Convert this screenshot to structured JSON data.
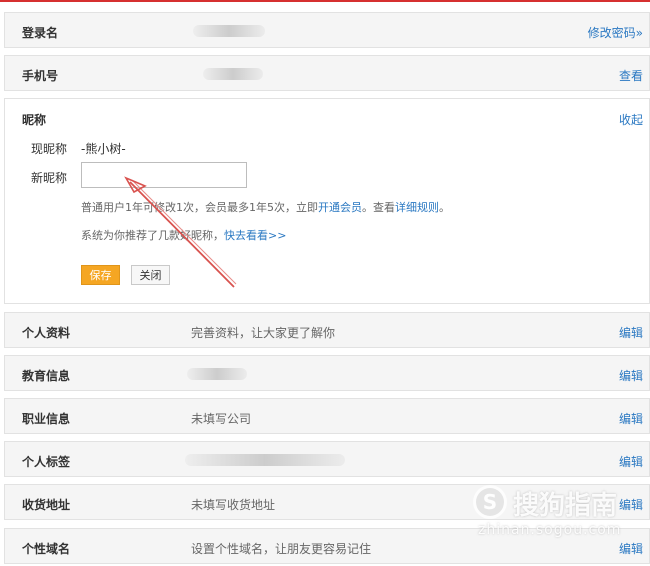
{
  "rows": {
    "login": {
      "label": "登录名",
      "action": "修改密码»"
    },
    "phone": {
      "label": "手机号",
      "action": "查看"
    },
    "profile": {
      "label": "个人资料",
      "value": "完善资料，让大家更了解你",
      "action": "编辑"
    },
    "education": {
      "label": "教育信息",
      "action": "编辑"
    },
    "career": {
      "label": "职业信息",
      "value": "未填写公司",
      "action": "编辑"
    },
    "tags": {
      "label": "个人标签",
      "action": "编辑"
    },
    "address": {
      "label": "收货地址",
      "value": "未填写收货地址",
      "action": "编辑"
    },
    "domain": {
      "label": "个性域名",
      "value": "设置个性域名，让朋友更容易记住",
      "action": "编辑"
    }
  },
  "nickname_panel": {
    "title": "昵称",
    "collapse": "收起",
    "current_label": "现昵称",
    "current_value": "-熊小树-",
    "new_label": "新昵称",
    "new_value": "",
    "hint1_text": "普通用户1年可修改1次，会员最多1年5次，立即",
    "hint1_link1": "开通会员",
    "hint1_mid": "。查看",
    "hint1_link2": "详细规则",
    "hint1_end": "。",
    "hint2_text": "系统为你推荐了几款好昵称，",
    "hint2_link": "快去看看>>",
    "save": "保存",
    "close": "关闭"
  },
  "watermark": {
    "logo": "S",
    "text": "搜狗指南",
    "url": "zhinan.sogou.com"
  },
  "colors": {
    "accent": "#2a78c2",
    "save": "#f5a623",
    "top_line": "#d63030",
    "arrow": "#d9534f"
  }
}
